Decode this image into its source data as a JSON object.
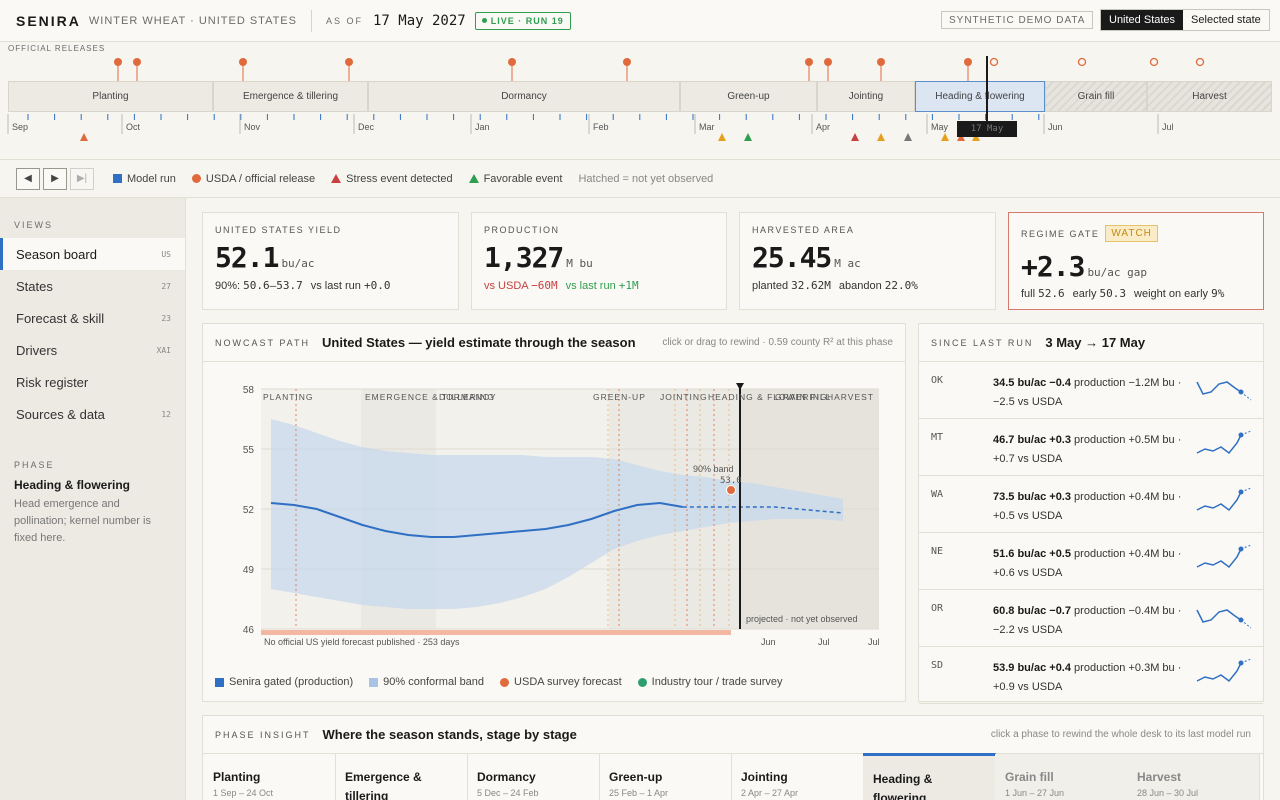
{
  "header": {
    "brand": "SENIRA",
    "crop": "WINTER WHEAT · UNITED STATES",
    "asof_label": "AS OF",
    "asof_date": "17 May 2027",
    "live_label": "LIVE · RUN 19",
    "demo_label": "SYNTHETIC DEMO DATA",
    "scope": [
      "United States",
      "Selected state"
    ]
  },
  "timeline": {
    "releases_label": "OFFICIAL RELEASES",
    "months": [
      "Sep",
      "Oct",
      "Nov",
      "Dec",
      "Jan",
      "Feb",
      "Mar",
      "Apr",
      "May",
      "Jun",
      "Jul"
    ],
    "phases": [
      "Planting",
      "Emergence & tillering",
      "Dormancy",
      "Green-up",
      "Jointing",
      "Heading & flowering",
      "Grain fill",
      "Harvest"
    ],
    "now_tag": "17 May"
  },
  "legend": {
    "model": "Model run",
    "usda": "USDA / official release",
    "stress": "Stress event detected",
    "favorable": "Favorable event",
    "hatch": "Hatched = not yet observed"
  },
  "sidebar": {
    "views_label": "VIEWS",
    "items": [
      {
        "label": "Season board",
        "badge": "US"
      },
      {
        "label": "States",
        "badge": "27"
      },
      {
        "label": "Forecast & skill",
        "badge": "23"
      },
      {
        "label": "Drivers",
        "badge": "XAI"
      },
      {
        "label": "Risk register",
        "badge": ""
      },
      {
        "label": "Sources & data",
        "badge": "12"
      }
    ],
    "phase_label": "PHASE",
    "phase_name": "Heading & flowering",
    "phase_desc": "Head emergence and pollination; kernel number is fixed here."
  },
  "cards": {
    "yield": {
      "label": "UNITED STATES YIELD",
      "value": "52.1",
      "unit": "bu/ac",
      "s1": "90%:",
      "s1v": "50.6–53.7",
      "s2": "vs last run",
      "s2v": "+0.0"
    },
    "prod": {
      "label": "PRODUCTION",
      "value": "1,327",
      "unit": "M bu",
      "s1": "vs USDA",
      "s1v": "−60M",
      "s2": "vs last run",
      "s2v": "+1M"
    },
    "area": {
      "label": "HARVESTED AREA",
      "value": "25.45",
      "unit": "M ac",
      "s1": "planted",
      "s1v": "32.62M",
      "s2": "abandon",
      "s2v": "22.0%"
    },
    "regime": {
      "label": "REGIME GATE",
      "badge": "WATCH",
      "value": "+2.3",
      "unit": "bu/ac gap",
      "s1": "full",
      "s1v": "52.6",
      "s2": "early",
      "s2v": "50.3",
      "s3": "weight on early",
      "s3v": "9%"
    }
  },
  "nowcast": {
    "kicker": "NOWCAST PATH",
    "title": "United States — yield estimate through the season",
    "hint": "click or drag to rewind · 0.59 county R² at this phase",
    "band_label": "90% band",
    "usda_label": "53.0",
    "proj_label": "projected · not yet observed",
    "nofc_label": "No official US yield forecast published · 253 days",
    "phase_labels": [
      "PLANTING",
      "EMERGENCE & TILLERING",
      "DORMANCY",
      "GREEN-UP",
      "JOINTING",
      "HEADING & FLOWERING",
      "GRAIN FILL",
      "HARVEST"
    ],
    "month_labels": [
      "Jun",
      "Jul",
      "Jul"
    ],
    "legend": [
      "Senira gated (production)",
      "90% conformal band",
      "USDA survey forecast",
      "Industry tour / trade survey"
    ]
  },
  "chart_data": {
    "type": "line",
    "title": "United States — yield estimate through the season",
    "ylim": [
      46,
      58
    ],
    "yticks": [
      46,
      49,
      52,
      55,
      58
    ],
    "series": [
      {
        "name": "Senira gated (production)",
        "x_weeks": [
          0,
          1,
          2,
          3,
          4,
          5,
          6,
          7,
          8,
          9,
          10,
          11,
          12,
          13,
          14,
          15,
          16,
          17,
          18,
          19,
          20,
          21,
          22,
          23,
          24,
          25
        ],
        "values": [
          52.3,
          52.2,
          52.0,
          51.6,
          51.2,
          50.9,
          50.7,
          50.6,
          50.6,
          50.7,
          50.8,
          50.9,
          51.0,
          51.2,
          51.5,
          51.9,
          52.2,
          52.3,
          52.1,
          52.1,
          52.1,
          52.1,
          52.1,
          52.0,
          51.9,
          51.8
        ]
      }
    ],
    "band_upper": [
      56.5,
      56.2,
      55.8,
      55.4,
      55.1,
      54.9,
      54.8,
      54.7,
      54.7,
      54.7,
      54.7,
      54.7,
      54.6,
      54.6,
      54.6,
      54.5,
      54.2,
      53.9,
      53.7,
      53.6,
      53.4,
      53.3,
      53.1,
      52.9,
      52.7,
      52.5
    ],
    "band_lower": [
      48.0,
      47.8,
      47.6,
      47.4,
      47.2,
      47.1,
      47.0,
      47.0,
      47.0,
      47.1,
      47.3,
      47.6,
      48.0,
      48.6,
      49.3,
      50.0,
      50.4,
      50.7,
      50.9,
      51.1,
      51.3,
      51.4,
      51.5,
      51.5,
      51.5,
      51.4
    ],
    "usda_point": 53.0
  },
  "since": {
    "kicker": "SINCE LAST RUN",
    "title": "3 May → 17 May",
    "rows": [
      {
        "state": "OK",
        "yield": "34.5 bu/ac",
        "delta": "−0.4",
        "rest": "production −1.2M bu · −2.5 vs USDA",
        "dir": "down"
      },
      {
        "state": "MT",
        "yield": "46.7 bu/ac",
        "delta": "+0.3",
        "rest": "production +0.5M bu · +0.7 vs USDA",
        "dir": "up"
      },
      {
        "state": "WA",
        "yield": "73.5 bu/ac",
        "delta": "+0.3",
        "rest": "production +0.4M bu · +0.5 vs USDA",
        "dir": "up"
      },
      {
        "state": "NE",
        "yield": "51.6 bu/ac",
        "delta": "+0.5",
        "rest": "production +0.4M bu · +0.6 vs USDA",
        "dir": "up"
      },
      {
        "state": "OR",
        "yield": "60.8 bu/ac",
        "delta": "−0.7",
        "rest": "production −0.4M bu · −2.2 vs USDA",
        "dir": "down"
      },
      {
        "state": "SD",
        "yield": "53.9 bu/ac",
        "delta": "+0.4",
        "rest": "production +0.3M bu · +0.9 vs USDA",
        "dir": "up"
      }
    ]
  },
  "insight": {
    "kicker": "PHASE INSIGHT",
    "title": "Where the season stands, stage by stage",
    "hint": "click a phase to rewind the whole desk to its last model run",
    "phases": [
      {
        "name": "Planting",
        "dates": "1 Sep – 24 Oct"
      },
      {
        "name": "Emergence & tillering",
        "dates": ""
      },
      {
        "name": "Dormancy",
        "dates": "5 Dec – 24 Feb"
      },
      {
        "name": "Green-up",
        "dates": "25 Feb – 1 Apr"
      },
      {
        "name": "Jointing",
        "dates": "2 Apr – 27 Apr"
      },
      {
        "name": "Heading & flowering",
        "dates": "28 Apr – 31 May"
      },
      {
        "name": "Grain fill",
        "dates": "1 Jun – 27 Jun"
      },
      {
        "name": "Harvest",
        "dates": "28 Jun – 30 Jul"
      }
    ]
  },
  "colors": {
    "accent": "#2f6fc4",
    "usda": "#e06a3c",
    "stress": "#c94040",
    "favorable": "#2f9e4f",
    "band": "#c5d7ec"
  }
}
